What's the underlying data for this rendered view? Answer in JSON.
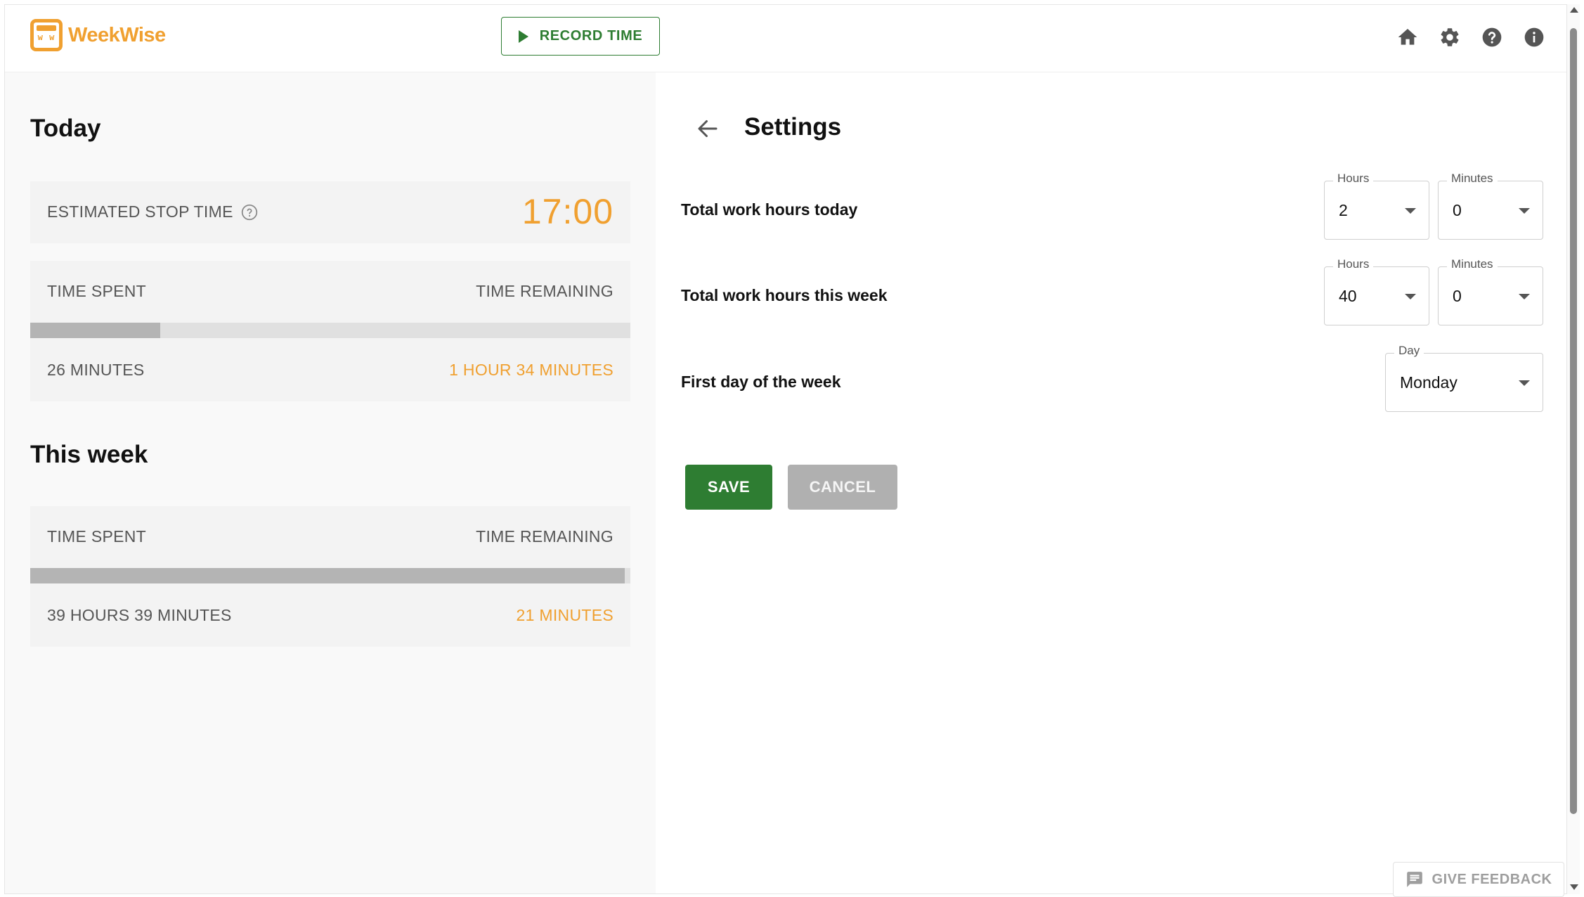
{
  "header": {
    "app_name": "WeekWise",
    "logo_glyph": "w w",
    "record_label": "RECORD TIME",
    "icons": [
      "home-icon",
      "gear-icon",
      "help-icon",
      "info-icon"
    ]
  },
  "today": {
    "heading": "Today",
    "estimated_stop_label": "ESTIMATED STOP TIME",
    "estimated_stop_value": "17:00",
    "time_spent_label": "TIME SPENT",
    "time_remaining_label": "TIME REMAINING",
    "time_spent_value": "26 MINUTES",
    "time_remaining_value": "1 HOUR 34 MINUTES",
    "progress_fraction": 0.217
  },
  "week": {
    "heading": "This week",
    "time_spent_label": "TIME SPENT",
    "time_remaining_label": "TIME REMAINING",
    "time_spent_value": "39 HOURS 39 MINUTES",
    "time_remaining_value": "21 MINUTES",
    "progress_fraction": 0.991
  },
  "settings": {
    "title": "Settings",
    "rows": [
      {
        "label": "Total work hours today",
        "hours_legend": "Hours",
        "hours_value": "2",
        "minutes_legend": "Minutes",
        "minutes_value": "0"
      },
      {
        "label": "Total work hours this week",
        "hours_legend": "Hours",
        "hours_value": "40",
        "minutes_legend": "Minutes",
        "minutes_value": "0"
      },
      {
        "label": "First day of the week",
        "day_legend": "Day",
        "day_value": "Monday"
      }
    ],
    "save_label": "SAVE",
    "cancel_label": "CANCEL"
  },
  "feedback": {
    "label": "GIVE FEEDBACK"
  },
  "colors": {
    "accent": "#f0a030",
    "primary": "#2e7d32",
    "muted": "#b0b0b0"
  }
}
